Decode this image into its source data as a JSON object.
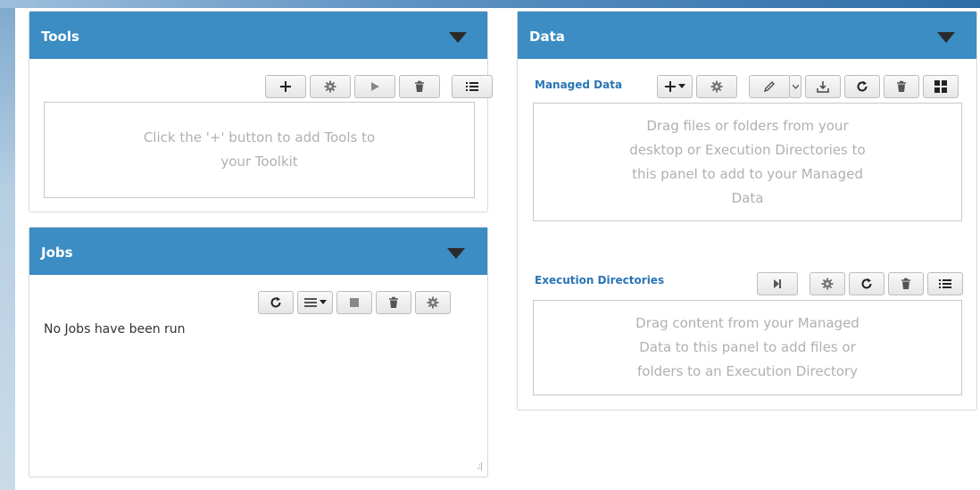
{
  "tools": {
    "title": "Tools",
    "empty_line1": "Click the '+' button to add Tools to",
    "empty_line2": "your Toolkit"
  },
  "jobs": {
    "title": "Jobs",
    "status_text": "No Jobs have been run"
  },
  "data": {
    "title": "Data",
    "managed_label": "Managed Data",
    "managed_line1": "Drag files or folders from your",
    "managed_line2": "desktop or Execution Directories to",
    "managed_line3": "this panel to add to your Managed",
    "managed_line4": "Data",
    "exec_label": "Execution Directories",
    "exec_line1": "Drag content from your Managed",
    "exec_line2": "Data to this panel to add files or",
    "exec_line3": "folders to an Execution Directory"
  },
  "colors": {
    "header": "#3b8dc4",
    "link": "#2a74b6",
    "placeholder": "#b0b0b0"
  },
  "icons": [
    "plus-icon",
    "gear-icon",
    "play-icon",
    "trash-icon",
    "list-icon",
    "refresh-icon",
    "menu-icon",
    "stop-icon",
    "pencil-icon",
    "download-icon",
    "grid-icon",
    "step-forward-icon",
    "chevron-down-icon"
  ]
}
